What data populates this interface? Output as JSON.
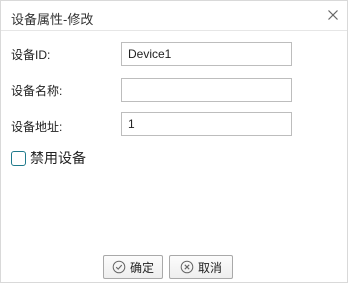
{
  "dialog": {
    "title": "设备属性-修改",
    "close_icon": "close-icon"
  },
  "form": {
    "device_id": {
      "label": "设备ID:",
      "value": "Device1"
    },
    "device_name": {
      "label": "设备名称:",
      "value": ""
    },
    "device_address": {
      "label": "设备地址:",
      "value": "1"
    },
    "disable_device": {
      "label": "禁用设备",
      "checked": false
    }
  },
  "buttons": {
    "ok": {
      "label": "确定",
      "icon": "check-circle-icon"
    },
    "cancel": {
      "label": "取消",
      "icon": "x-circle-icon"
    }
  }
}
